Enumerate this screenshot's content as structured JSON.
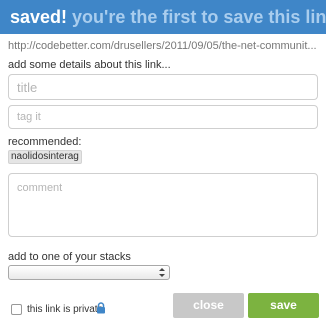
{
  "header": {
    "saved_label": "saved!",
    "message": "you're the first to save this link!"
  },
  "link_url": "http://codebetter.com/drusellers/2011/09/05/the-net-communit...",
  "details_label": "add some details about this link...",
  "title_field": {
    "placeholder": "title",
    "value": ""
  },
  "tag_field": {
    "placeholder": "tag it",
    "value": ""
  },
  "recommended": {
    "label": "recommended:",
    "tags": [
      "naolidosinterag"
    ]
  },
  "comment_field": {
    "placeholder": "comment",
    "value": ""
  },
  "stacks": {
    "label": "add to one of your stacks",
    "selected": ""
  },
  "private": {
    "label": "this link is private",
    "checked": false,
    "icon": "lock-icon"
  },
  "buttons": {
    "close": "close",
    "save": "save"
  },
  "colors": {
    "header_bg": "#3f86c8",
    "header_secondary_text": "#a9cdee",
    "save_button": "#7cb340",
    "close_button": "#c8c8c8",
    "lock": "#3f86c8"
  }
}
